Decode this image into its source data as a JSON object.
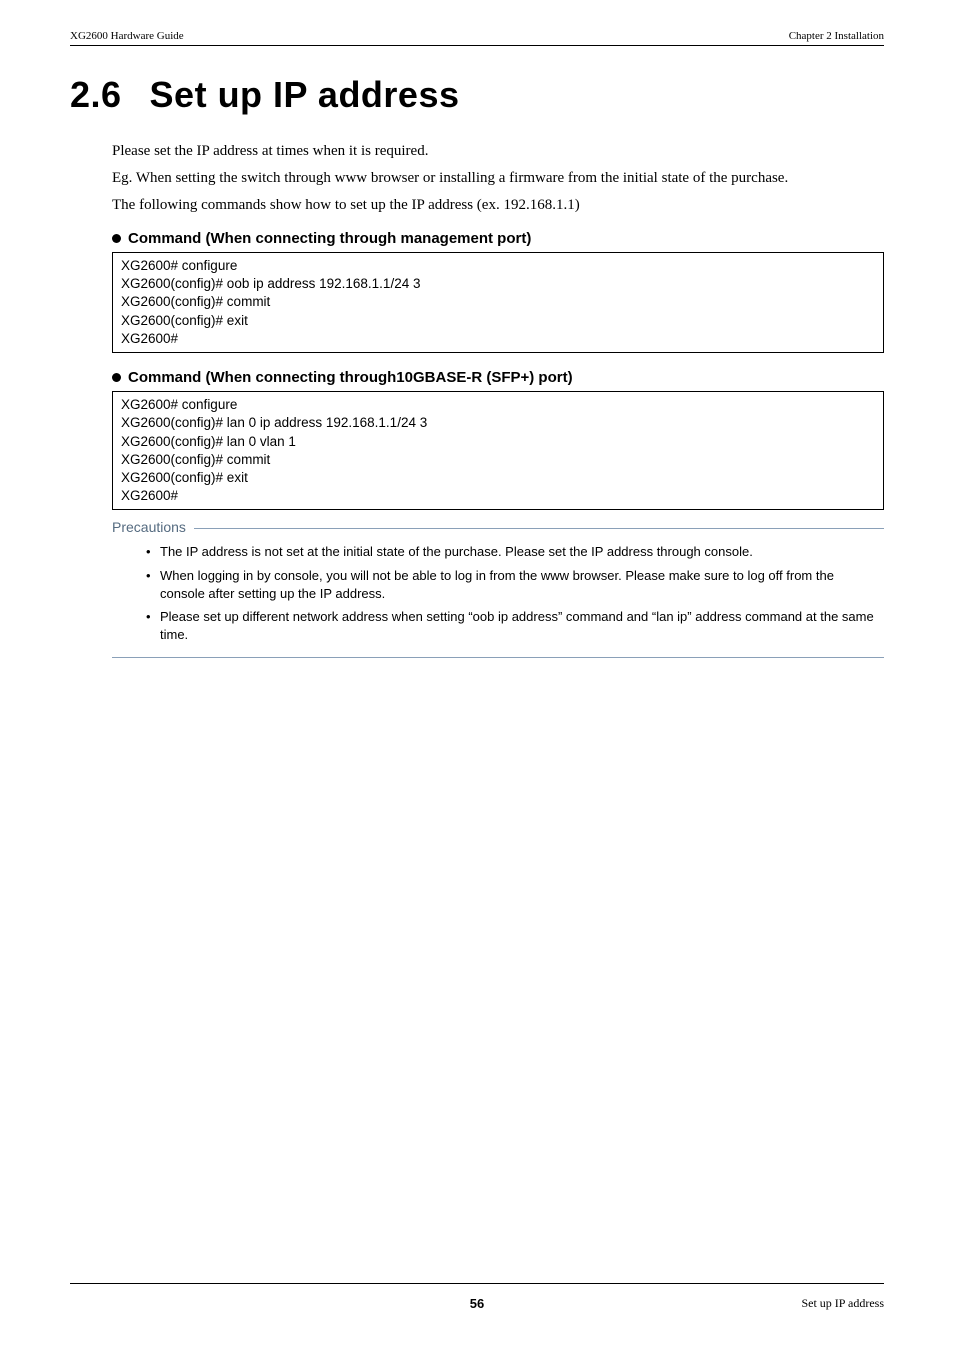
{
  "header": {
    "left": "XG2600 Hardware Guide",
    "right": "Chapter 2 Installation"
  },
  "section": {
    "number": "2.6",
    "title": "Set up IP address"
  },
  "paragraphs": {
    "p1": "Please set the IP address at times when it is required.",
    "p2": "Eg. When setting the switch through www browser or installing a firmware from the initial state of the purchase.",
    "p3": "The following commands show how to set up the IP address (ex. 192.168.1.1)"
  },
  "command1": {
    "heading": "Command (When connecting through management port)",
    "code": "XG2600# configure\nXG2600(config)# oob ip address 192.168.1.1/24 3\nXG2600(config)# commit\nXG2600(config)# exit\nXG2600#"
  },
  "command2": {
    "heading": "Command (When connecting through10GBASE-R (SFP+) port)",
    "code": "XG2600# configure\nXG2600(config)# lan 0 ip address 192.168.1.1/24 3\nXG2600(config)# lan 0 vlan 1\nXG2600(config)# commit\nXG2600(config)# exit\nXG2600#"
  },
  "precautions": {
    "label": "Precautions",
    "items": [
      "The IP address is not set at the initial state of the purchase. Please set the IP address through console.",
      "When logging in by console, you will not be able to log in from the www browser. Please make sure to log off from the console after setting up the IP address.",
      "Please set up different network address when setting “oob ip address” command and “lan ip” address command at the same time."
    ]
  },
  "footer": {
    "page": "56",
    "right": "Set up IP address"
  }
}
